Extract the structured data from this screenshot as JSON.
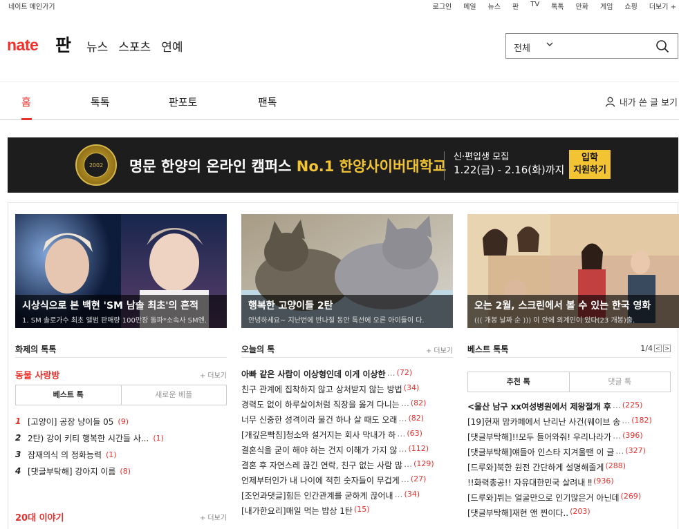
{
  "topbar": {
    "home": "네이트 메인가기",
    "links": [
      "로그인",
      "메일",
      "뉴스",
      "판",
      "TV",
      "톡톡",
      "만화",
      "게임",
      "쇼핑",
      "더보기 +"
    ]
  },
  "header": {
    "logo": "nate",
    "service": "판",
    "nav": [
      "뉴스",
      "스포츠",
      "연예"
    ],
    "search": {
      "scope": "전체",
      "value": ""
    }
  },
  "mainnav": {
    "tabs": [
      "홈",
      "톡톡",
      "판포토",
      "팬톡"
    ],
    "active": "홈",
    "mine": "내가 쓴 글 보기"
  },
  "banner": {
    "seal_text": "2002",
    "headline": "명문 한양의 온라인 캠퍼스",
    "headline_accent": "No.1 한양사이버대학교",
    "recruit_title": "신·편입생 모집",
    "recruit_dates": "1.22(금) - 2.16(화)까지",
    "apply_line1": "입학",
    "apply_line2": "지원하기"
  },
  "cards": [
    {
      "title": "시상식으로 본 백현 'SM 남솔 최초'의 흔적",
      "sub": "1. SM 솔로가수 최초 앨범 판매량 100만장 돌파*소속사 SM엔."
    },
    {
      "title": "행복한 고양이들 2탄",
      "sub": "안녕하세요~ 지난번에 반나절 동안 톡선에 오른 아이들이 다."
    },
    {
      "title": "오는 2월, 스크린에서 볼 수 있는 한국 영화",
      "sub": "((( 개봉 날짜 순 ))) 이 안에 외계인이 있다(23 개봉)출."
    }
  ],
  "hot": {
    "title": "화제의 톡톡",
    "pets": {
      "title": "동물 사랑방",
      "more": "+ 더보기",
      "tabs": [
        "베스트 톡",
        "새로운 베플"
      ],
      "items": [
        {
          "rank": "1",
          "text": "[고양이] 공장 냥이들 05",
          "count": "(9)"
        },
        {
          "rank": "2",
          "text": "2탄) 강이 키티 행복한 시간들 사...",
          "count": "(1)"
        },
        {
          "rank": "3",
          "text": "잠재의식 의 정화능력",
          "count": "(1)"
        },
        {
          "rank": "4",
          "text": "[댓글부탁해] 강아지 이름",
          "count": "(8)"
        }
      ]
    },
    "twenties": {
      "title": "20대 이야기",
      "more": "+ 더보기"
    }
  },
  "today": {
    "title": "오늘의 톡",
    "more": "+ 더보기",
    "items": [
      {
        "text": "아빠 같은 사람이 이상형인데 이게 이상한",
        "count": "(72)",
        "bold": true
      },
      {
        "text": "친구 관계에 집착하지 않고 상처받지 않는 방법",
        "count": "(34)",
        "bold": false
      },
      {
        "text": "경력도 없이 하루살이처럼 직장을 옮겨 다니는",
        "count": "(82)",
        "bold": false
      },
      {
        "text": "너무 신중한 성격이라 물건 하나 살 때도 오래",
        "count": "(82)",
        "bold": false
      },
      {
        "text": "[개깊은빡침]청소와 설거지는 회사 막내가 하",
        "count": "(63)",
        "bold": false
      },
      {
        "text": "결혼식을 굳이 해야 하는 건지 이해가 가지 않",
        "count": "(112)",
        "bold": false
      },
      {
        "text": "결혼 후 자연스레 끊긴 연락, 친구 없는 사람 많",
        "count": "(129)",
        "bold": false
      },
      {
        "text": "언제부터인가 내 나이에 적힌 숫자들이 무겁게",
        "count": "(27)",
        "bold": false
      },
      {
        "text": "[조언과댓글]힘든 인간관계를 굳하게 끊어내",
        "count": "(34)",
        "bold": false
      },
      {
        "text": "[내가한요리]매일 먹는 밥상 1탄",
        "count": "(15)",
        "bold": false
      }
    ]
  },
  "best": {
    "title": "베스트 톡톡",
    "page": "1/4",
    "prev": "<",
    "next": ">",
    "tabs": [
      "추천 톡",
      "댓글 톡"
    ],
    "items": [
      {
        "text": "<울산 남구 xx여성병원에서 제왕절개 후",
        "count": "(225)",
        "bold": true
      },
      {
        "text": "[19]현재 맘카페에서 난리난 사건(웨이브 송",
        "count": "(182)",
        "bold": false
      },
      {
        "text": "[댓글부탁해]!!모두 들어와줘! 우리나라가",
        "count": "(396)",
        "bold": false
      },
      {
        "text": "[댓글부탁해]얘들아 인스타 지겨울땐 이 글",
        "count": "(327)",
        "bold": false
      },
      {
        "text": "[드루와]북한 원전 간단하게 설명해줄게",
        "count": "(288)",
        "bold": false
      },
      {
        "text": "!!화력총공!! 자유대한민국 살려내 ‼",
        "count": "(936)",
        "bold": false
      },
      {
        "text": "[드루와]뷔는 얼굴만으로 인기많은거 아닌데",
        "count": "(269)",
        "bold": false
      },
      {
        "text": "[댓글부탁해]재현 앤 찐이다..",
        "count": "(203)",
        "bold": false
      }
    ]
  },
  "colors": {
    "accent": "#e8312d",
    "banner_bg": "#1d1d1d",
    "banner_gold": "#f2c433"
  }
}
